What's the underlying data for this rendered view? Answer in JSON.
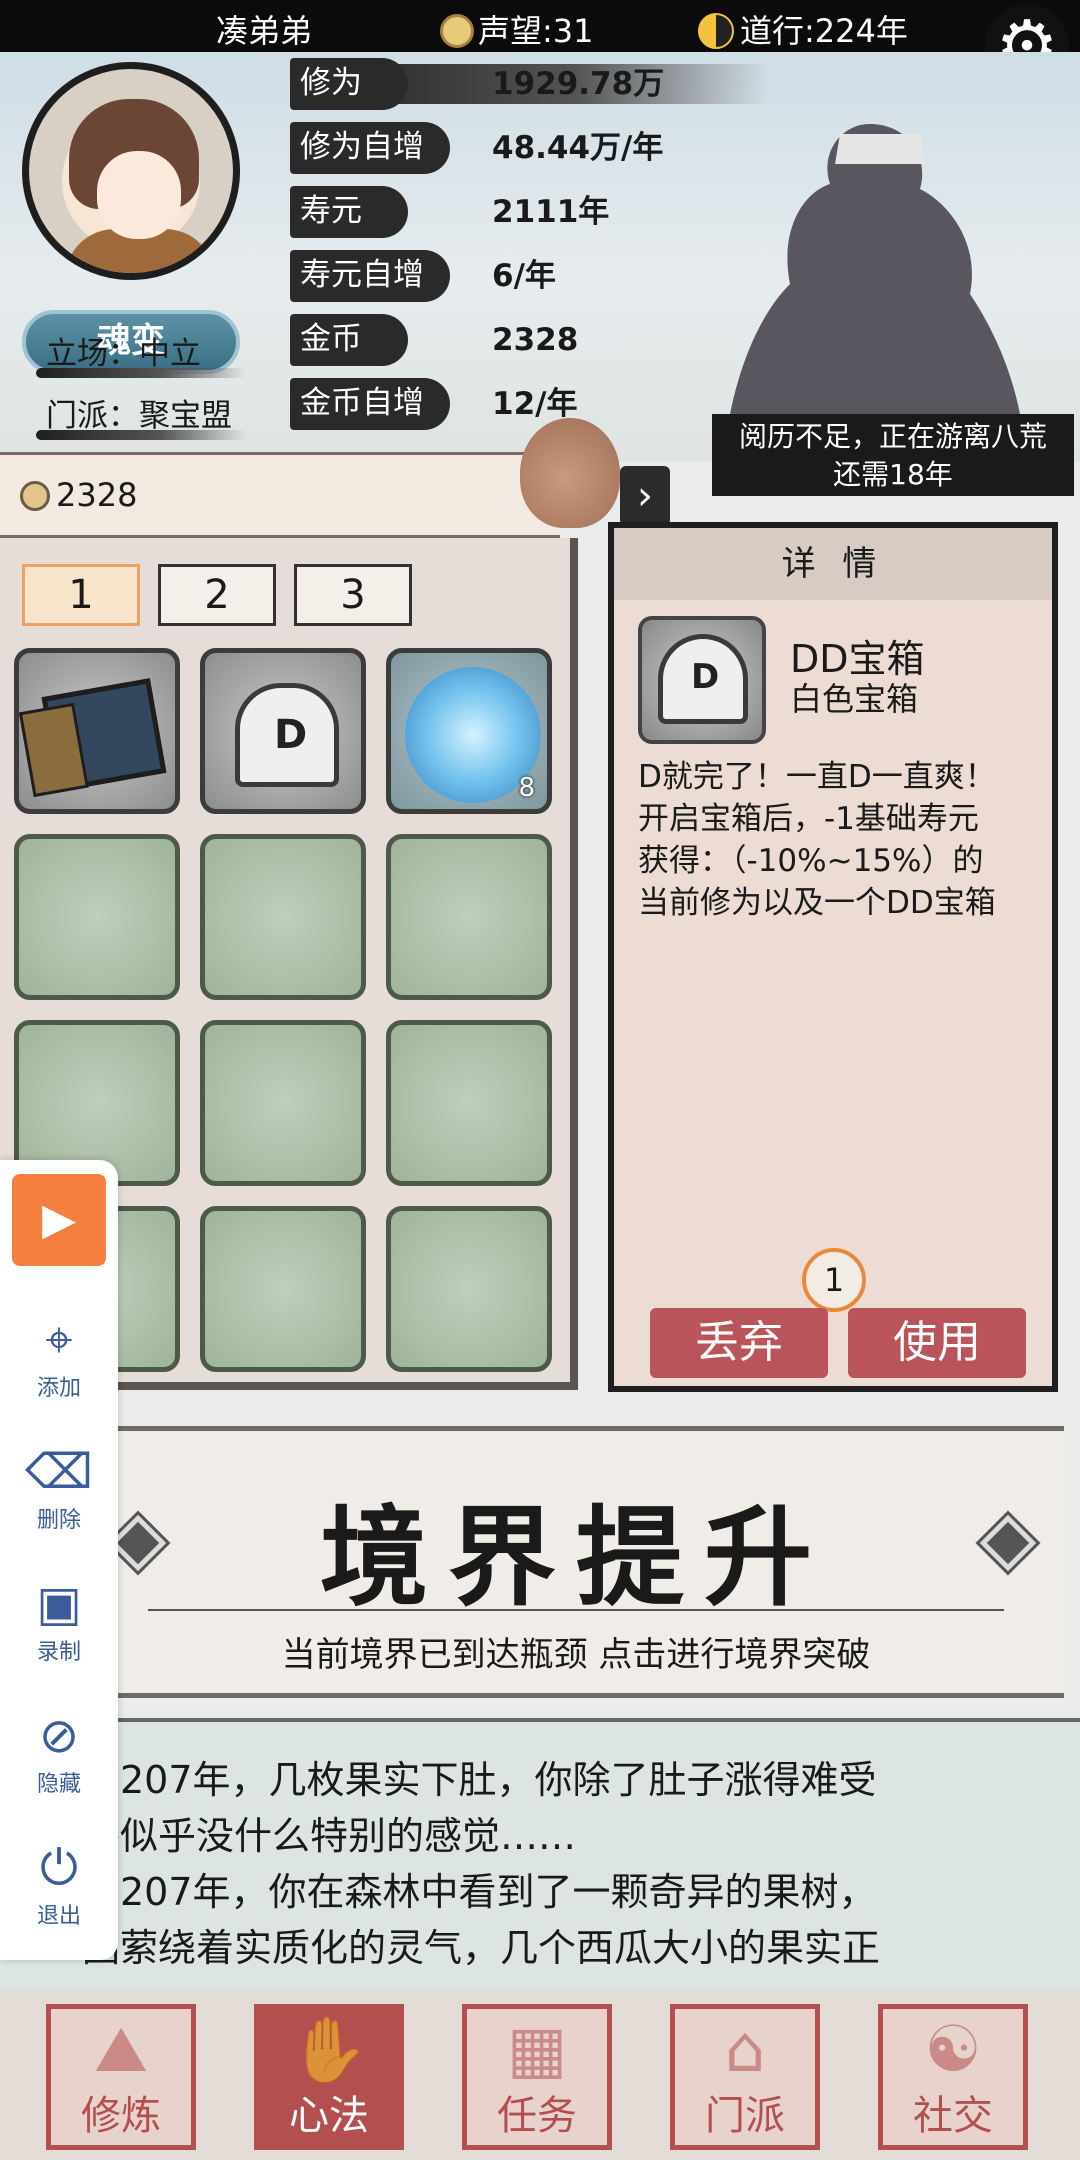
{
  "topbar": {
    "player_name": "凑弟弟",
    "reputation": "声望:31",
    "dao": "道行:224年"
  },
  "profile": {
    "realm": "魂变",
    "stance": "立场：中立",
    "sect": "门派：聚宝盟"
  },
  "stats": [
    {
      "label": "修为",
      "value": "1929.78万"
    },
    {
      "label": "修为自增",
      "value": "48.44万/年"
    },
    {
      "label": "寿元",
      "value": "2111年"
    },
    {
      "label": "寿元自增",
      "value": "6/年"
    },
    {
      "label": "金币",
      "value": "2328"
    },
    {
      "label": "金币自增",
      "value": "12/年"
    }
  ],
  "travel": {
    "line1": "阅历不足，正在游离八荒",
    "line2": "还需18年"
  },
  "currency": {
    "gold": "2328"
  },
  "inventory": {
    "tabs": [
      "1",
      "2",
      "3"
    ],
    "active_tab": "1",
    "items": [
      {
        "icon": "book-icon"
      },
      {
        "icon": "chest-icon",
        "letter": "D"
      },
      {
        "icon": "orb-icon",
        "count": "8"
      }
    ]
  },
  "detail": {
    "title": "详 情",
    "item_name": "DD宝箱",
    "item_type": "白色宝箱",
    "desc": [
      "D就完了！一直D一直爽！",
      "开启宝箱后，-1基础寿元",
      "获得：（-10%~15%）的",
      "当前修为以及一个DD宝箱"
    ],
    "quantity": "1",
    "discard": "丢弃",
    "use": "使用"
  },
  "banner": {
    "title": "境界提升",
    "subtitle": "当前境界已到达瓶颈 点击进行境界突破"
  },
  "log": [
    "历207年，几枚果实下肚，你除了肚子涨得难受",
    "外似乎没什么特别的感觉……",
    "历207年，你在森林中看到了一颗奇异的果树，",
    "围萦绕着实质化的灵气，几个西瓜大小的果实正"
  ],
  "nav": [
    {
      "label": "修炼",
      "glyph": "⛰"
    },
    {
      "label": "心法",
      "glyph": "✋"
    },
    {
      "label": "任务",
      "glyph": "▦"
    },
    {
      "label": "门派",
      "glyph": "⌂"
    },
    {
      "label": "社交",
      "glyph": "☯"
    }
  ],
  "tools": {
    "add": "添加",
    "remove": "删除",
    "record": "录制",
    "hide": "隐藏",
    "exit": "退出"
  },
  "colors": {
    "accent_red": "#b34f4f",
    "play_orange": "#f57f3e",
    "tool_blue": "#3b5c9a"
  }
}
